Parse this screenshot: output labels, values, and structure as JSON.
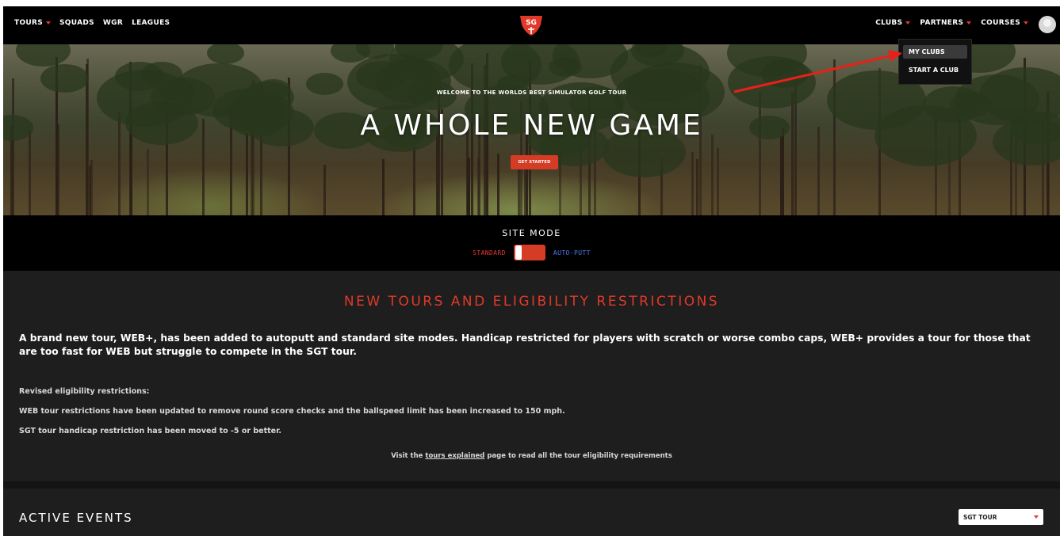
{
  "nav": {
    "left": [
      {
        "label": "TOURS",
        "caret": true
      },
      {
        "label": "SQUADS",
        "caret": false
      },
      {
        "label": "WGR",
        "caret": false
      },
      {
        "label": "LEAGUES",
        "caret": false
      }
    ],
    "right": [
      {
        "label": "CLUBS",
        "caret": true
      },
      {
        "label": "PARTNERS",
        "caret": true
      },
      {
        "label": "COURSES",
        "caret": true
      }
    ],
    "logo_text": "SG"
  },
  "clubs_menu": {
    "items": [
      "MY CLUBS",
      "START A CLUB"
    ]
  },
  "hero": {
    "subtitle": "WELCOME TO THE WORLDS BEST SIMULATOR GOLF TOUR",
    "title": "A WHOLE NEW GAME",
    "cta": "GET STARTED"
  },
  "site_mode": {
    "title": "SITE MODE",
    "standard_label": "STANDARD",
    "autoputt_label": "AUTO-PUTT"
  },
  "announcement": {
    "title": "NEW TOURS AND ELIGIBILITY RESTRICTIONS",
    "lead": "A brand new tour, WEB+, has been added to autoputt and standard site modes. Handicap restricted for players with scratch or worse combo caps, WEB+ provides a tour for those that are too fast for WEB but struggle to compete in the SGT tour.",
    "p1": "Revised eligibility restrictions:",
    "p2": "WEB tour restrictions have been updated to remove round score checks and the ballspeed limit has been increased to 150 mph.",
    "p3": "SGT tour handicap restriction has been moved to -5 or better.",
    "foot_before": "Visit the ",
    "foot_link": "tours explained",
    "foot_after": " page to read all the tour eligibility requirements"
  },
  "events": {
    "title": "ACTIVE EVENTS",
    "tour_select": "SGT TOUR"
  },
  "colors": {
    "accent": "#e0392a",
    "autoputt": "#4b7bf0",
    "background": "#1e1e1e",
    "nav": "#000000"
  }
}
